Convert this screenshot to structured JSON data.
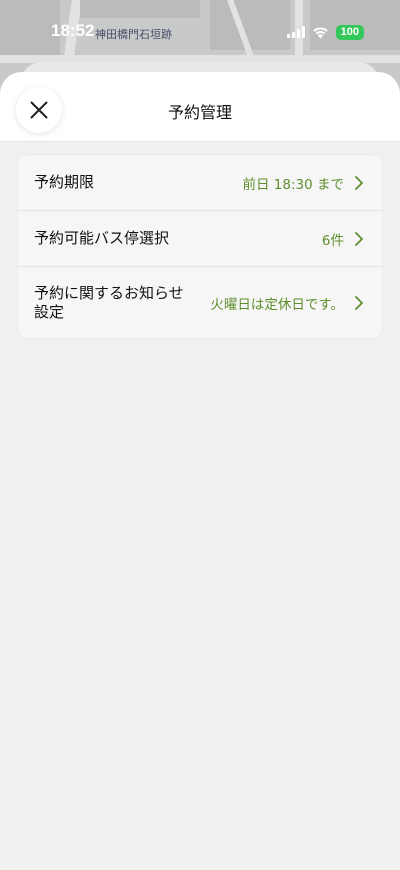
{
  "status_bar": {
    "time": "18:52",
    "location_label": "神田橋門石垣跡",
    "battery": "100"
  },
  "sheet": {
    "title": "予約管理",
    "close_icon": "close-icon"
  },
  "settings": [
    {
      "label": "予約期限",
      "value": "前日 18:30 まで"
    },
    {
      "label": "予約可能バス停選択",
      "value": "6件"
    },
    {
      "label_line1": "予約に関するお知らせ",
      "label_line2": "設定",
      "value": "火曜日は定休日です。"
    }
  ],
  "colors": {
    "accent": "#5f8f2d",
    "battery": "#34c759",
    "background": "#f1f1f1"
  }
}
